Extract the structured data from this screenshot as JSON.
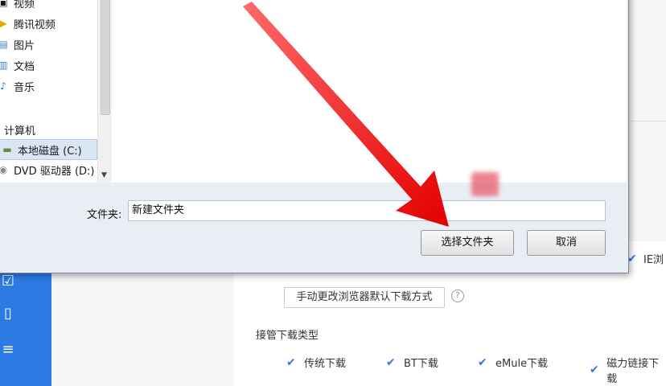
{
  "dialog": {
    "nav": {
      "items": [
        {
          "label": "视频",
          "icon": "video-icon"
        },
        {
          "label": "腾讯视频",
          "icon": "folder-icon"
        },
        {
          "label": "图片",
          "icon": "picture-icon"
        },
        {
          "label": "文档",
          "icon": "document-icon"
        },
        {
          "label": "音乐",
          "icon": "music-icon"
        },
        {
          "label": "计算机",
          "icon": "computer-icon"
        },
        {
          "label": "本地磁盘 (C:)",
          "icon": "drive-icon"
        },
        {
          "label": "DVD 驱动器 (D:)",
          "icon": "dvd-icon"
        }
      ]
    },
    "folder_label": "文件夹:",
    "folder_value": "新建文件夹",
    "select_button": "选择文件夹",
    "cancel_button": "取消"
  },
  "background": {
    "ie_label": "IE浏",
    "change_browser_button": "手动更改浏览器默认下载方式",
    "help_icon": "?",
    "section_title": "接管下载类型",
    "checkboxes": [
      {
        "label": "传统下载",
        "checked": true
      },
      {
        "label": "BT下载",
        "checked": true
      },
      {
        "label": "eMule下载",
        "checked": true
      },
      {
        "label": "磁力链接下载",
        "checked": true
      }
    ]
  },
  "colors": {
    "accent": "#2c7be5",
    "annotation_arrow": "#ff1a1a"
  }
}
